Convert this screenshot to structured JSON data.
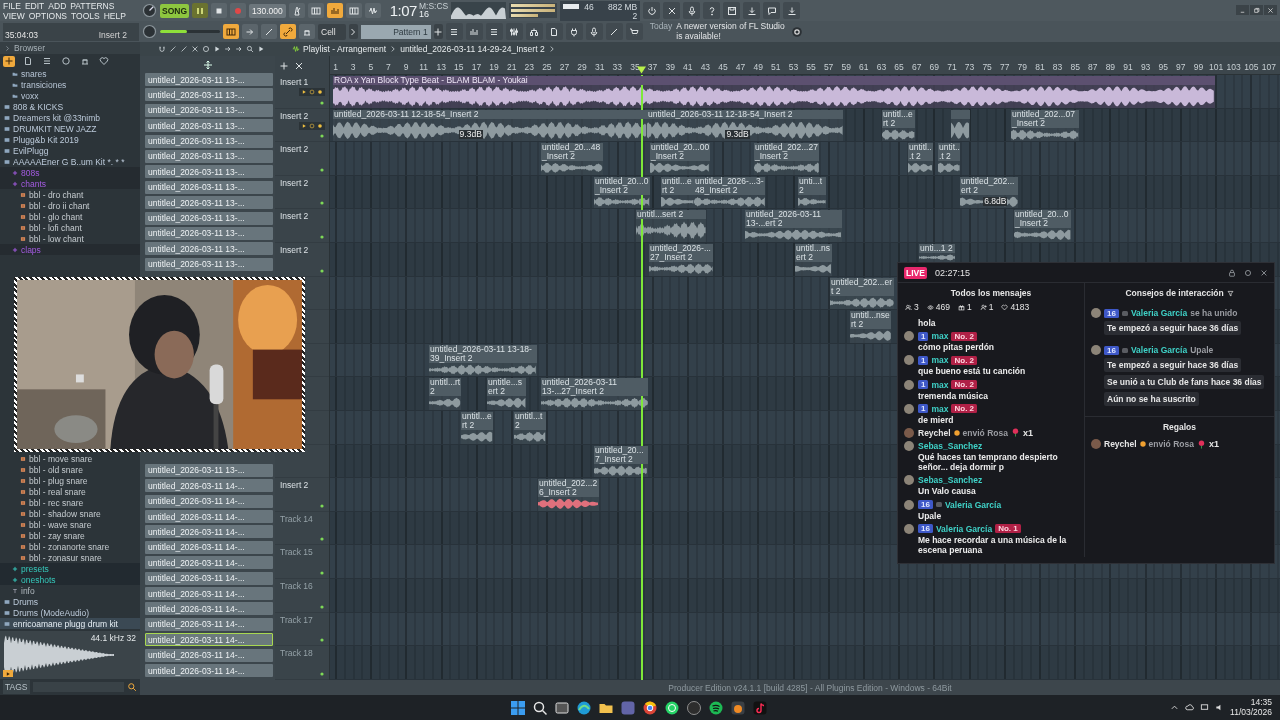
{
  "menu": [
    "FILE",
    "EDIT",
    "ADD",
    "PATTERNS",
    "VIEW",
    "OPTIONS",
    "TOOLS",
    "HELP"
  ],
  "transport": {
    "mode": "SONG",
    "tempo": "130.000",
    "time": "1:07",
    "time_cs": "16",
    "time_unit": "M:S:CS",
    "cpu": "46",
    "memory": "882 MB",
    "polyphony": "2"
  },
  "hint_bar": {
    "position": "35:04:03",
    "target": "Insert 2"
  },
  "master_volume": {
    "level": 0.45
  },
  "snap": "Cell",
  "pattern": "Pattern 1",
  "news": {
    "day": "Today",
    "text": "A newer version of FL Studio is available!"
  },
  "browser": {
    "title": "Browser",
    "tree_top": [
      {
        "children": [
          {
            "label": "snares",
            "kind": "folder",
            "selected": false
          },
          {
            "label": "transiciones",
            "kind": "folder",
            "selected": false
          },
          {
            "label": "voxx",
            "kind": "folder",
            "selected": false
          }
        ]
      },
      {
        "label": "808 & KICKS",
        "kind": "pack",
        "selected": false
      },
      {
        "label": "Dreamers kit @33nimb",
        "kind": "pack",
        "selected": false
      },
      {
        "label": "DRUMKIT NEW JAZZ",
        "kind": "pack",
        "selected": false
      },
      {
        "label": "Plugg&b Kit 2019",
        "kind": "pack",
        "selected": false
      },
      {
        "label": "EvilPlugg",
        "kind": "pack",
        "selected": false
      },
      {
        "label": "AAAAAEner G B..um Kit *. * *",
        "kind": "pack",
        "selected": false,
        "children": [
          {
            "label": "808s",
            "kind": "tag",
            "selected": false
          },
          {
            "label": "chants",
            "kind": "tag",
            "selected": false,
            "children": [
              {
                "label": "bbl - dro chant",
                "kind": "file",
                "selected": false
              },
              {
                "label": "bbl - dro ii chant",
                "kind": "file",
                "selected": false
              },
              {
                "label": "bbl - glo chant",
                "kind": "file",
                "selected": false
              },
              {
                "label": "bbl - lofi chant",
                "kind": "file",
                "selected": false
              },
              {
                "label": "bbl - low chant",
                "kind": "file",
                "selected": false
              }
            ]
          },
          {
            "label": "claps",
            "kind": "tag",
            "selected": false
          }
        ]
      }
    ],
    "tree_bottom": [
      {
        "children": [
          {
            "children": [
              {
                "label": "bbl - move snare",
                "kind": "file",
                "selected": false
              },
              {
                "label": "bbl - old snare",
                "kind": "file",
                "selected": false
              },
              {
                "label": "bbl - plug snare",
                "kind": "file",
                "selected": false
              },
              {
                "label": "bbl - real snare",
                "kind": "file",
                "selected": false
              },
              {
                "label": "bbl - rec snare",
                "kind": "file",
                "selected": false
              },
              {
                "label": "bbl - shadow snare",
                "kind": "file",
                "selected": false
              },
              {
                "label": "bbl - wave snare",
                "kind": "file",
                "selected": false
              },
              {
                "label": "bbl - zay snare",
                "kind": "file",
                "selected": false
              },
              {
                "label": "bbl - zonanorte snare",
                "kind": "file",
                "selected": false
              },
              {
                "label": "bbl - zonasur snare",
                "kind": "file",
                "selected": false
              }
            ]
          },
          {
            "label": "presets",
            "kind": "link",
            "selected": false
          },
          {
            "label": "oneshots",
            "kind": "link",
            "selected": false
          },
          {
            "label": "info",
            "kind": "note",
            "selected": false
          }
        ]
      },
      {
        "label": "Drums",
        "kind": "pack",
        "selected": false
      },
      {
        "label": "Drums (ModeAudio)",
        "kind": "pack",
        "selected": false
      },
      {
        "label": "enricoamane plugg drum kit",
        "kind": "pack",
        "selected": true
      }
    ],
    "preview_info": "44.1 kHz 32",
    "tags_label": "TAGS"
  },
  "channels_top": [
    {
      "label": "untitled_2026-03-11 13-...",
      "selected": false
    },
    {
      "label": "untitled_2026-03-11 13-...",
      "selected": false
    },
    {
      "label": "untitled_2026-03-11 13-...",
      "selected": false
    },
    {
      "label": "untitled_2026-03-11 13-...",
      "selected": false
    },
    {
      "label": "untitled_2026-03-11 13-...",
      "selected": false
    },
    {
      "label": "untitled_2026-03-11 13-...",
      "selected": false
    },
    {
      "label": "untitled_2026-03-11 13-...",
      "selected": false
    },
    {
      "label": "untitled_2026-03-11 13-...",
      "selected": false
    },
    {
      "label": "untitled_2026-03-11 13-...",
      "selected": false
    },
    {
      "label": "untitled_2026-03-11 13-...",
      "selected": false
    },
    {
      "label": "untitled_2026-03-11 13-...",
      "selected": false
    },
    {
      "label": "untitled_2026-03-11 13-...",
      "selected": false
    },
    {
      "label": "untitled_2026-03-11 13-...",
      "selected": false
    }
  ],
  "channels_bottom": [
    {
      "label": "untitled_2026-03-11 13-...",
      "selected": false
    },
    {
      "label": "untitled_2026-03-11 14-...",
      "selected": false
    },
    {
      "label": "untitled_2026-03-11 14-...",
      "selected": false
    },
    {
      "label": "untitled_2026-03-11 14-...",
      "selected": false
    },
    {
      "label": "untitled_2026-03-11 14-...",
      "selected": false
    },
    {
      "label": "untitled_2026-03-11 14-...",
      "selected": false
    },
    {
      "label": "untitled_2026-03-11 14-...",
      "selected": false
    },
    {
      "label": "untitled_2026-03-11 14-...",
      "selected": false
    },
    {
      "label": "untitled_2026-03-11 14-...",
      "selected": false
    },
    {
      "label": "untitled_2026-03-11 14-...",
      "selected": false
    },
    {
      "label": "untitled_2026-03-11 14-...",
      "selected": false
    },
    {
      "label": "untitled_2026-03-11 14-...",
      "selected": true
    },
    {
      "label": "untitled_2026-03-11 14-...",
      "selected": false
    },
    {
      "label": "untitled_2026-03-11 14-...",
      "selected": false
    }
  ],
  "playlist": {
    "title": "Playlist - Arrangement",
    "pattern": "untitled_2026-03-11 14-29-24_Insert 2",
    "ruler": [
      "1",
      "3",
      "5",
      "7",
      "9",
      "11",
      "13",
      "15",
      "17",
      "19",
      "21",
      "23",
      "25",
      "27",
      "29",
      "31",
      "33",
      "35",
      "37",
      "39",
      "41",
      "43",
      "45",
      "47",
      "49",
      "51",
      "53",
      "55",
      "57",
      "59",
      "61",
      "63",
      "65",
      "67",
      "69",
      "71",
      "73",
      "75",
      "77",
      "79",
      "81",
      "83",
      "85",
      "87",
      "89",
      "91",
      "93",
      "95",
      "97",
      "99",
      "101",
      "103",
      "105",
      "107"
    ],
    "playhead": {
      "level": 0.328
    },
    "tracks": [
      {
        "kind": "insert",
        "label": "Insert 1",
        "controls": true
      },
      {
        "kind": "insert",
        "label": "Insert 2",
        "controls": true
      },
      {
        "kind": "insert",
        "label": "Insert 2",
        "controls": false
      },
      {
        "kind": "insert",
        "label": "Insert 2",
        "controls": false
      },
      {
        "kind": "insert",
        "label": "Insert 2",
        "controls": false
      },
      {
        "kind": "insert",
        "label": "Insert 2",
        "controls": false
      },
      {
        "kind": "covered"
      },
      {
        "kind": "covered"
      },
      {
        "kind": "covered"
      },
      {
        "kind": "covered"
      },
      {
        "kind": "covered"
      },
      {
        "kind": "covered"
      },
      {
        "kind": "insert",
        "label": "Insert 2",
        "controls": false
      },
      {
        "kind": "track",
        "label": "Track 14",
        "controls": false
      },
      {
        "kind": "track",
        "label": "Track 15",
        "controls": false
      },
      {
        "kind": "track",
        "label": "Track 16",
        "controls": false
      },
      {
        "kind": "track",
        "label": "Track 17",
        "controls": false
      },
      {
        "kind": "track",
        "label": "Track 18",
        "controls": false
      }
    ],
    "clips": [
      {
        "label": "ROA x Yan Block Type Beat - BLAM BLAM - Youkai",
        "color": "#c9b9d9"
      },
      {
        "label": "untitled_2026-03-11 12-18-54_Insert 2",
        "gain": "9.3dB",
        "color": "#8e9a9f"
      },
      {
        "label": "untitled_2026-03-11 12-18-54_Insert 2",
        "gain": "9.3dB",
        "color": "#8e9a9f"
      },
      {
        "label": "untitl...ert 2",
        "color": "#8e9a9f"
      },
      {
        "color": "#8e9a9f"
      },
      {
        "label": "untitled_202...07_Insert 2",
        "color": "#8e9a9f"
      },
      {
        "label": "untitled_20...48_Insert 2",
        "color": "#8e9a9f"
      },
      {
        "label": "untitled_20...00_Insert 2",
        "color": "#8e9a9f"
      },
      {
        "label": "untitled_202...27_Insert 2",
        "color": "#8e9a9f"
      },
      {
        "label": "untitl...t 2",
        "color": "#8e9a9f"
      },
      {
        "label": "untit...t 2",
        "color": "#8e9a9f"
      },
      {
        "label": "untitled_20...0_Insert 2",
        "color": "#8e9a9f"
      },
      {
        "label": "untitl...ert 2",
        "color": "#8e9a9f"
      },
      {
        "label": "untitled_2026-...3-48_Insert 2",
        "color": "#8e9a9f"
      },
      {
        "label": "unti...t 2",
        "color": "#8e9a9f"
      },
      {
        "label": "untitled_202...ert 2",
        "gain": "6.8dB",
        "color": "#8e9a9f"
      },
      {
        "label": "untitl...sert 2",
        "color": "#8e9a9f"
      },
      {
        "label": "untitled_2026-03-11 13-...ert 2",
        "color": "#8e9a9f"
      },
      {
        "label": "untitled_20...0_Insert 2",
        "color": "#8e9a9f"
      },
      {
        "label": "untitled_2026-...27_Insert 2",
        "color": "#8e9a9f"
      },
      {
        "label": "untitl...nsert 2",
        "color": "#8e9a9f"
      },
      {
        "label": "unti...1 2",
        "color": "#8e9a9f"
      },
      {
        "label": "untitled_202...ert 2",
        "color": "#8e9a9f"
      },
      {
        "label": "untitl...nsert 2",
        "color": "#8e9a9f"
      },
      {
        "label": "untitled_2026-03-11 13-18-39_Insert 2",
        "color": "#8e9a9f"
      },
      {
        "label": "untitl...rt 2",
        "color": "#8e9a9f"
      },
      {
        "label": "untitle...sert 2",
        "color": "#8e9a9f"
      },
      {
        "label": "untitled_2026-03-11 13-...27_Insert 2",
        "color": "#8e9a9f"
      },
      {
        "label": "untitl...ert 2",
        "color": "#8e9a9f"
      },
      {
        "label": "untitl...t 2",
        "color": "#8e9a9f"
      },
      {
        "label": "untitled_20...7_Insert 2",
        "color": "#8e9a9f"
      },
      {
        "label": "untitled_202...26_Insert 2",
        "color": "#e0707c"
      }
    ]
  },
  "live_panel": {
    "badge": "LIVE",
    "duration": "02:27:15",
    "left_title": "Todos los mensajes",
    "right_title": "Consejos de interacción",
    "gifts_title": "Regalos",
    "stats": [
      {
        "kind": "people",
        "value": "3"
      },
      {
        "kind": "eye",
        "value": "469"
      },
      {
        "kind": "gift",
        "value": "1"
      },
      {
        "kind": "follower",
        "value": "1"
      },
      {
        "kind": "heart",
        "value": "4183"
      }
    ],
    "messages": [
      {
        "kind": "text",
        "text": "hola"
      },
      {
        "kind": "chat",
        "user": "max",
        "badges": [
          {
            "kind": "level",
            "text": "1"
          },
          {
            "kind": "rank",
            "text": "No. 2"
          }
        ],
        "text": "cómo pitas perdón"
      },
      {
        "kind": "chat",
        "user": "max",
        "badges": [
          {
            "kind": "level",
            "text": "1"
          },
          {
            "kind": "rank",
            "text": "No. 2"
          }
        ],
        "text": "que bueno está tu canción"
      },
      {
        "kind": "chat",
        "user": "max",
        "badges": [
          {
            "kind": "level",
            "text": "1"
          },
          {
            "kind": "rank",
            "text": "No. 2"
          }
        ],
        "text": "tremenda música"
      },
      {
        "kind": "chat",
        "user": "max",
        "badges": [
          {
            "kind": "level",
            "text": "1"
          },
          {
            "kind": "rank",
            "text": "No. 2"
          }
        ],
        "text": "de mierd"
      },
      {
        "kind": "gift",
        "user": "Reychel",
        "action": "envió Rosa",
        "count": "x1"
      },
      {
        "kind": "chat",
        "user": "Sebas_Sanchez",
        "text": "Qué haces tan temprano despierto señor... deja dormir p"
      },
      {
        "kind": "chat",
        "user": "Sebas_Sanchez",
        "text": "Un Valo causa"
      },
      {
        "kind": "chat",
        "user": "Valeria García",
        "badges": [
          {
            "kind": "level",
            "text": "16"
          },
          {
            "kind": "fan"
          }
        ],
        "text": "Upale"
      },
      {
        "kind": "chat",
        "user": "Valeria García",
        "badges": [
          {
            "kind": "level",
            "text": "16"
          },
          {
            "kind": "rank",
            "text": "No. 1"
          }
        ],
        "text": "Me hace recordar a una música de la escena peruana"
      }
    ],
    "tips": [
      {
        "user": "Valeria García",
        "badges": [
          {
            "kind": "level",
            "text": "16"
          },
          {
            "kind": "fan"
          }
        ],
        "action": "se ha unido",
        "notes": [
          "Te empezó a seguir hace 36 días"
        ]
      },
      {
        "user": "Valeria García",
        "badges": [
          {
            "kind": "level",
            "text": "16"
          },
          {
            "kind": "fan"
          }
        ],
        "action": "Upale",
        "notes": [
          "Te empezó a seguir hace 36 días",
          "Se unió a tu Club de fans hace 36 días",
          "Aún no se ha suscrito"
        ]
      }
    ],
    "gifts": [
      {
        "user": "Reychel",
        "action": "envió Rosa",
        "count": "x1"
      }
    ]
  },
  "status_text": "Producer Edition v24.1.1 [build 4285] - All Plugins Edition - Windows - 64Bit",
  "taskbar": {
    "time": "14:35",
    "date": "11/03/2026"
  }
}
